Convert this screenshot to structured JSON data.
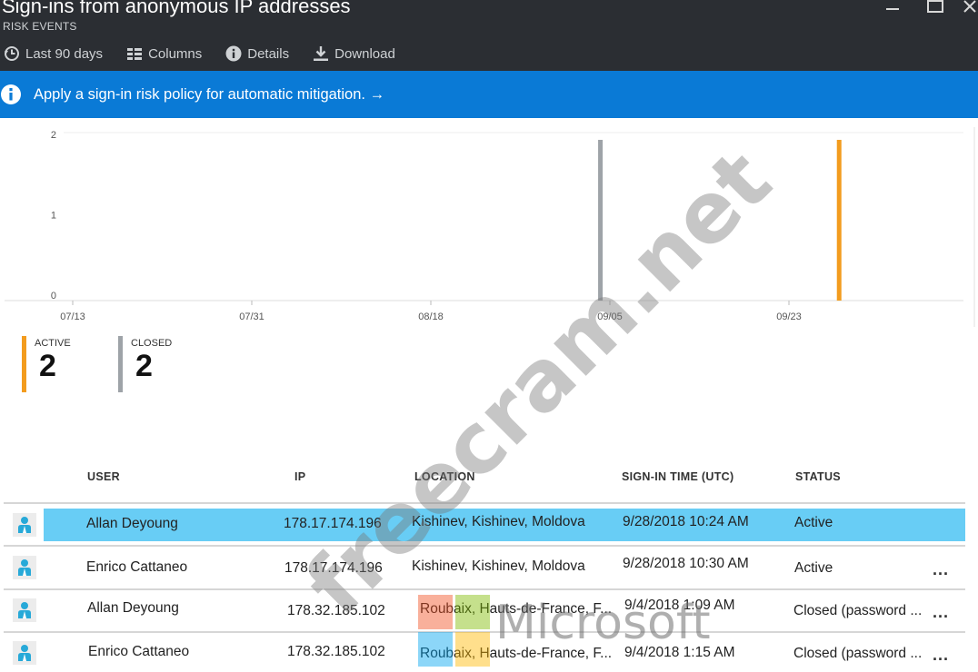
{
  "window": {
    "title": "Sign-ins from anonymous IP addresses",
    "subtitle": "RISK EVENTS"
  },
  "toolbar": {
    "items": [
      {
        "label": "Last 90 days",
        "icon": "clock-icon"
      },
      {
        "label": "Columns",
        "icon": "columns-icon"
      },
      {
        "label": "Details",
        "icon": "info-icon"
      },
      {
        "label": "Download",
        "icon": "download-icon"
      }
    ]
  },
  "infobar": {
    "text": "Apply a sign-in risk policy for automatic mitigation. →"
  },
  "chart_data": {
    "type": "bar",
    "x_ticks": [
      "07/13",
      "07/31",
      "08/18",
      "09/05",
      "09/23"
    ],
    "y_ticks": [
      "0",
      "1",
      "2"
    ],
    "ylim": [
      0,
      2
    ],
    "series": [
      {
        "name": "CLOSED",
        "color": "#9ea3a8",
        "points": [
          {
            "x": "09/04",
            "y": 2
          }
        ]
      },
      {
        "name": "ACTIVE",
        "color": "#f39c1e",
        "points": [
          {
            "x": "09/28",
            "y": 2
          }
        ]
      }
    ]
  },
  "counters": {
    "active": {
      "label": "ACTIVE",
      "value": "2",
      "color": "#f39c1e"
    },
    "closed": {
      "label": "CLOSED",
      "value": "2",
      "color": "#9ea3a8"
    }
  },
  "table": {
    "headers": {
      "user": "USER",
      "ip": "IP",
      "location": "LOCATION",
      "time": "SIGN-IN TIME (UTC)",
      "status": "STATUS"
    },
    "rows": [
      {
        "user": "Allan Deyoung",
        "ip": "178.17.174.196",
        "location": "Kishinev, Kishinev, Moldova",
        "time": "9/28/2018 10:24 AM",
        "status": "Active",
        "selected": true,
        "more": ""
      },
      {
        "user": "Enrico Cattaneo",
        "ip": "178.17.174.196",
        "location": "Kishinev, Kishinev, Moldova",
        "time": "9/28/2018 10:30 AM",
        "status": "Active",
        "selected": false,
        "more": "..."
      },
      {
        "user": "Allan Deyoung",
        "ip": "178.32.185.102",
        "location": "Roubaix, Hauts-de-France, F...",
        "time": "9/4/2018 1:09 AM",
        "status": "Closed (password ...",
        "selected": false,
        "more": "..."
      },
      {
        "user": "Enrico Cattaneo",
        "ip": "178.32.185.102",
        "location": "Roubaix, Hauts-de-France, F...",
        "time": "9/4/2018 1:15 AM",
        "status": "Closed (password ...",
        "selected": false,
        "more": "..."
      }
    ]
  },
  "watermarks": {
    "site": "freecram.net",
    "brand": "Microsoft"
  }
}
